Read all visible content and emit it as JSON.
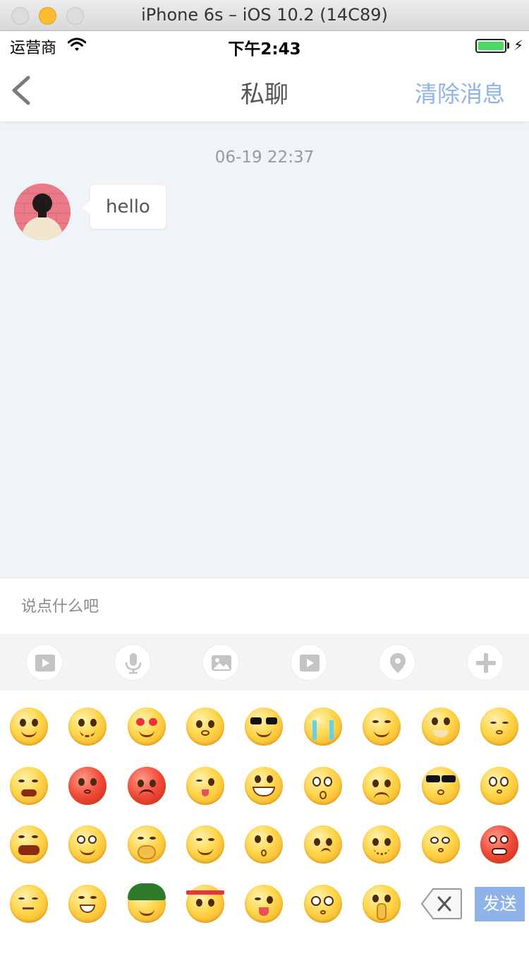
{
  "window": {
    "title": "iPhone 6s – iOS 10.2 (14C89)"
  },
  "status_bar": {
    "carrier": "运营商",
    "time": "下午2:43"
  },
  "nav": {
    "title": "私聊",
    "action": "清除消息",
    "back_icon": "chevron-left-icon"
  },
  "chat": {
    "timestamp": "06-19 22:37",
    "messages": [
      {
        "sender": "other",
        "text": "hello"
      }
    ]
  },
  "input": {
    "placeholder": "说点什么吧",
    "value": ""
  },
  "toolbar": {
    "items": [
      "video-icon",
      "microphone-icon",
      "image-icon",
      "video-icon",
      "location-pin-icon",
      "plus-icon"
    ]
  },
  "emoji_panel": {
    "rows": 4,
    "columns": 9,
    "count": 34,
    "send_label": "发送"
  },
  "colors": {
    "accent": "#8fb3e8",
    "chat_background": "#f0f3f7",
    "toolbar_background": "#f4f4f4",
    "battery": "#4cd964"
  }
}
